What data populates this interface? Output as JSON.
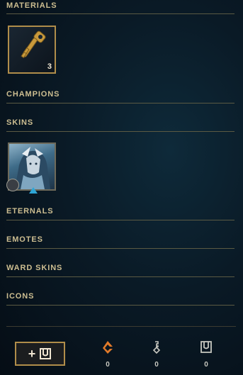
{
  "sections": {
    "materials": "MATERIALS",
    "champions": "CHAMPIONS",
    "skins": "SKINS",
    "eternals": "ETERNALS",
    "emotes": "EMOTES",
    "ward_skins": "WARD SKINS",
    "icons": "ICONS"
  },
  "materials_items": [
    {
      "icon": "key-fragment-icon",
      "count": "3"
    }
  ],
  "skins_items": [
    {
      "icon": "skin-portrait",
      "rarity_color": "#2fa6d6"
    }
  ],
  "footer": {
    "add_button_label": "+",
    "currencies": [
      {
        "icon": "orange-essence-icon",
        "value": "0",
        "color": "#e07a2a"
      },
      {
        "icon": "key-fragment-icon",
        "value": "0",
        "color": "#c8c8c0"
      },
      {
        "icon": "chest-icon",
        "value": "0",
        "color": "#c8c8c0"
      }
    ]
  },
  "colors": {
    "accent_gold": "#b08d4a",
    "section_text": "#cdbe91"
  }
}
